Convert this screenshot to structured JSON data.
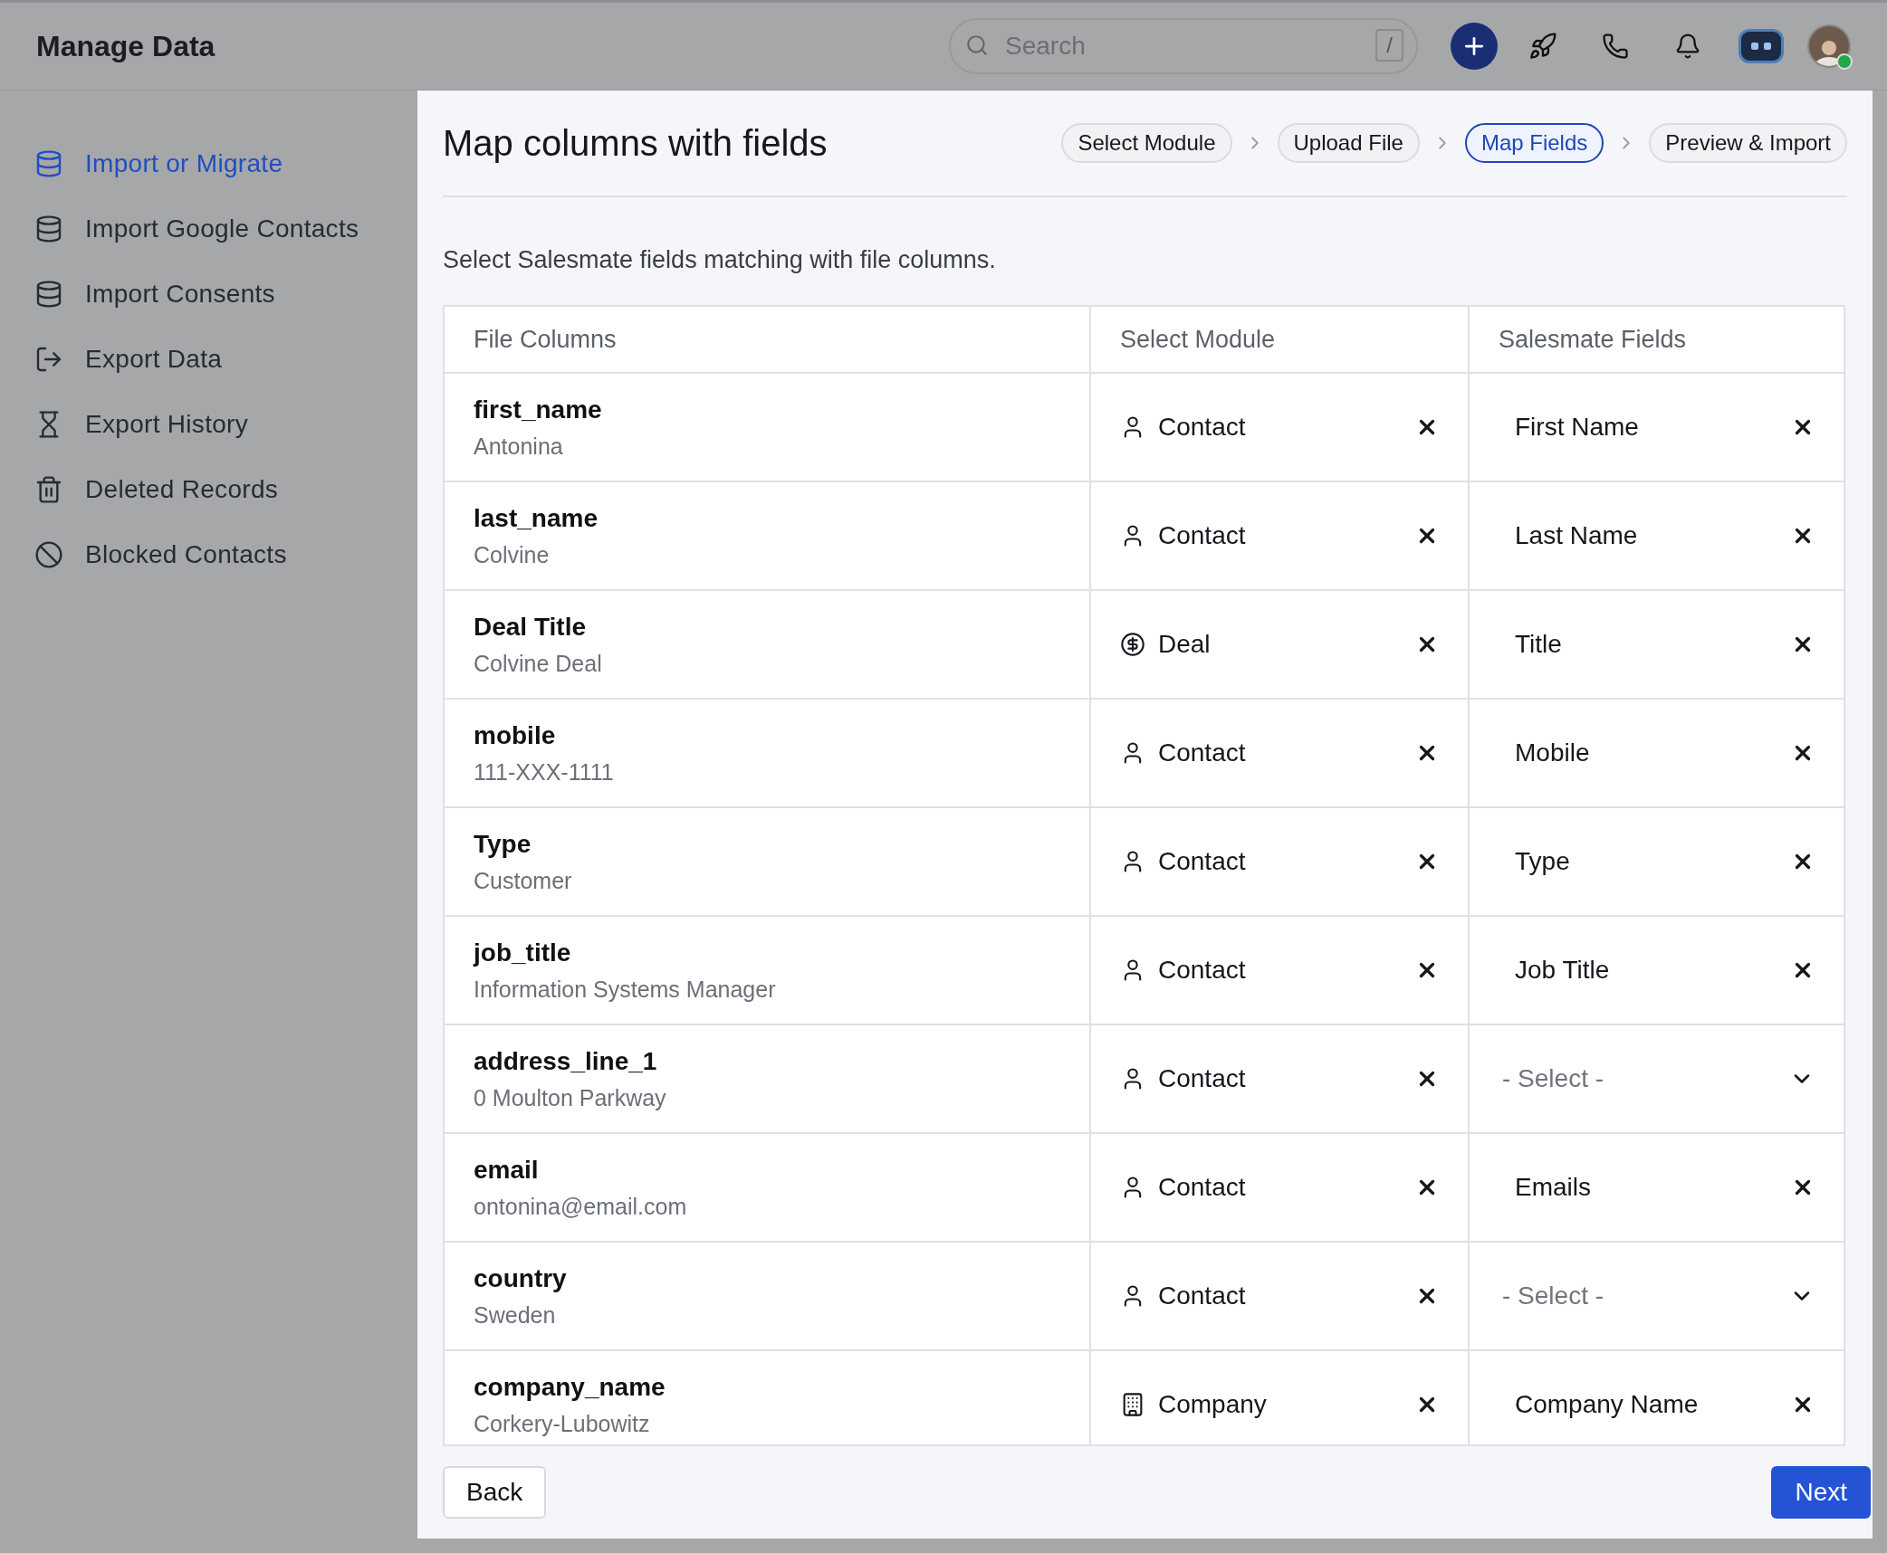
{
  "header": {
    "title": "Manage Data",
    "search": {
      "placeholder": "Search",
      "shortcut": "/"
    },
    "user": {
      "online": true
    }
  },
  "sidebar": {
    "items": [
      {
        "label": "Import or Migrate",
        "kind": "import",
        "selected": true
      },
      {
        "label": "Import Google Contacts",
        "kind": "import",
        "selected": false
      },
      {
        "label": "Import Consents",
        "kind": "import",
        "selected": false
      },
      {
        "label": "Export Data",
        "kind": "export",
        "selected": false
      },
      {
        "label": "Export History",
        "kind": "history",
        "selected": false
      },
      {
        "label": "Deleted Records",
        "kind": "deleted",
        "selected": false
      },
      {
        "label": "Blocked Contacts",
        "kind": "blocked",
        "selected": false
      }
    ]
  },
  "panel": {
    "title": "Map columns with fields",
    "steps": [
      {
        "label": "Select Module",
        "selected": false
      },
      {
        "label": "Upload File",
        "selected": false
      },
      {
        "label": "Map Fields",
        "selected": true
      },
      {
        "label": "Preview & Import",
        "selected": false
      }
    ],
    "instructions": "Select Salesmate fields matching with file columns.",
    "table": {
      "columns": [
        "File Columns",
        "Select Module",
        "Salesmate Fields"
      ],
      "rows": [
        {
          "column": "first_name",
          "sample": "Antonina",
          "module": {
            "label": "Contact",
            "kind": "contact"
          },
          "field": {
            "value": "First Name"
          }
        },
        {
          "column": "last_name",
          "sample": "Colvine",
          "module": {
            "label": "Contact",
            "kind": "contact"
          },
          "field": {
            "value": "Last Name"
          }
        },
        {
          "column": "Deal Title",
          "sample": "Colvine Deal",
          "module": {
            "label": "Deal",
            "kind": "deal"
          },
          "field": {
            "value": "Title"
          }
        },
        {
          "column": "mobile",
          "sample": "111-XXX-1111",
          "module": {
            "label": "Contact",
            "kind": "contact"
          },
          "field": {
            "value": "Mobile"
          }
        },
        {
          "column": "Type",
          "sample": "Customer",
          "module": {
            "label": "Contact",
            "kind": "contact"
          },
          "field": {
            "value": "Type"
          }
        },
        {
          "column": "job_title",
          "sample": "Information Systems Manager",
          "module": {
            "label": "Contact",
            "kind": "contact"
          },
          "field": {
            "value": "Job Title"
          }
        },
        {
          "column": "address_line_1",
          "sample": "0 Moulton Parkway",
          "module": {
            "label": "Contact",
            "kind": "contact"
          },
          "field": {
            "placeholder": "- Select -"
          }
        },
        {
          "column": "email",
          "sample": "ontonina@email.com",
          "module": {
            "label": "Contact",
            "kind": "contact"
          },
          "field": {
            "value": "Emails"
          }
        },
        {
          "column": "country",
          "sample": "Sweden",
          "module": {
            "label": "Contact",
            "kind": "contact"
          },
          "field": {
            "placeholder": "- Select -"
          }
        },
        {
          "column": "company_name",
          "sample": "Corkery-Lubowitz",
          "module": {
            "label": "Company",
            "kind": "company"
          },
          "field": {
            "value": "Company Name"
          }
        }
      ]
    },
    "buttons": {
      "back": "Back",
      "next": "Next"
    }
  }
}
